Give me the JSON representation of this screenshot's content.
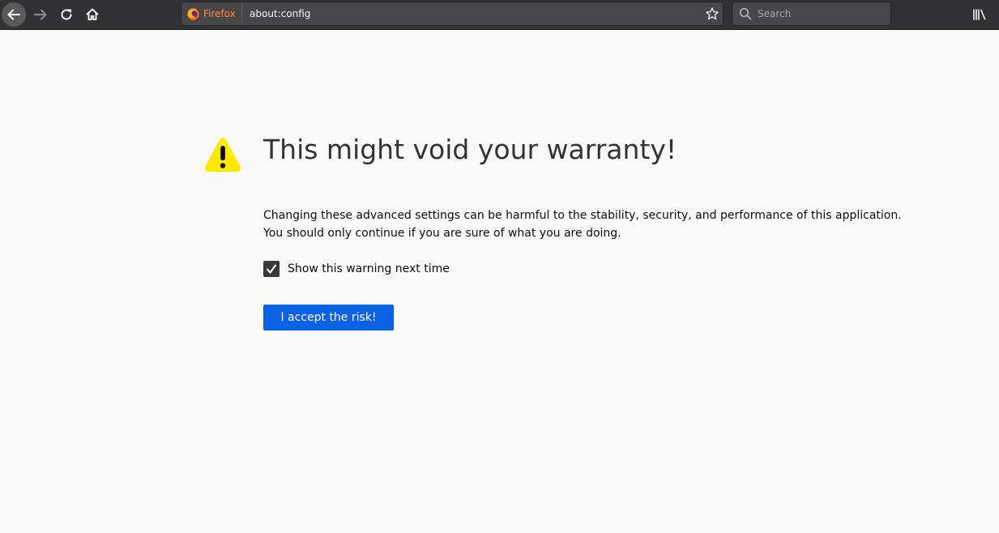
{
  "toolbar": {
    "back_icon": "back-arrow-icon",
    "forward_icon": "forward-arrow-icon",
    "reload_icon": "reload-icon",
    "home_icon": "home-icon",
    "library_icon": "library-icon"
  },
  "urlbar": {
    "identity_label": "Firefox",
    "url": "about:config",
    "bookmark_icon": "star-icon"
  },
  "searchbar": {
    "placeholder": "Search"
  },
  "warning": {
    "title": "This might void your warranty!",
    "description_line1": "Changing these advanced settings can be harmful to the stability, security, and performance of this application.",
    "description_line2": "You should only continue if you are sure of what you are doing.",
    "checkbox_label": "Show this warning next time",
    "checkbox_checked": true,
    "accept_label": "I accept the risk!"
  },
  "colors": {
    "toolbar_bg": "#323234",
    "page_bg": "#f9f9fa",
    "accent_button": "#0a62e2",
    "warning_yellow": "#ffe900",
    "firefox_label": "#ff8a3c"
  }
}
